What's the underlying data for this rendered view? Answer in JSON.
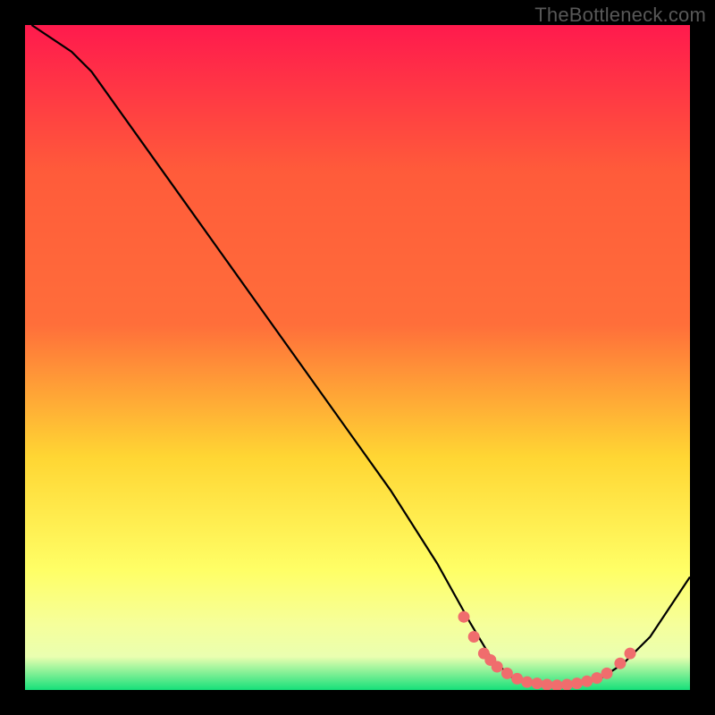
{
  "watermark": "TheBottleneck.com",
  "chart_data": {
    "type": "line",
    "title": "",
    "xlabel": "",
    "ylabel": "",
    "xlim": [
      0,
      100
    ],
    "ylim": [
      0,
      100
    ],
    "background_gradient": {
      "top": "#ff1a4d",
      "mid_upper": "#ff6e3a",
      "mid": "#ffd633",
      "lower": "#ffff66",
      "low_band": "#eaffb0",
      "bottom": "#16e07a"
    },
    "series": [
      {
        "name": "curve",
        "color": "#000000",
        "type": "line",
        "points": [
          {
            "x": 1,
            "y": 100
          },
          {
            "x": 7,
            "y": 96
          },
          {
            "x": 10,
            "y": 93
          },
          {
            "x": 15,
            "y": 86
          },
          {
            "x": 25,
            "y": 72
          },
          {
            "x": 35,
            "y": 58
          },
          {
            "x": 45,
            "y": 44
          },
          {
            "x": 55,
            "y": 30
          },
          {
            "x": 62,
            "y": 19
          },
          {
            "x": 67,
            "y": 10
          },
          {
            "x": 70,
            "y": 5
          },
          {
            "x": 73,
            "y": 2
          },
          {
            "x": 76,
            "y": 1
          },
          {
            "x": 80,
            "y": 0.7
          },
          {
            "x": 84,
            "y": 1
          },
          {
            "x": 87,
            "y": 2
          },
          {
            "x": 90,
            "y": 4
          },
          {
            "x": 94,
            "y": 8
          },
          {
            "x": 100,
            "y": 17
          }
        ]
      },
      {
        "name": "dots",
        "color": "#f06d6d",
        "type": "scatter",
        "points": [
          {
            "x": 66,
            "y": 11
          },
          {
            "x": 67.5,
            "y": 8
          },
          {
            "x": 69,
            "y": 5.5
          },
          {
            "x": 70,
            "y": 4.5
          },
          {
            "x": 71,
            "y": 3.5
          },
          {
            "x": 72.5,
            "y": 2.5
          },
          {
            "x": 74,
            "y": 1.7
          },
          {
            "x": 75.5,
            "y": 1.2
          },
          {
            "x": 77,
            "y": 1
          },
          {
            "x": 78.5,
            "y": 0.8
          },
          {
            "x": 80,
            "y": 0.7
          },
          {
            "x": 81.5,
            "y": 0.8
          },
          {
            "x": 83,
            "y": 1
          },
          {
            "x": 84.5,
            "y": 1.3
          },
          {
            "x": 86,
            "y": 1.8
          },
          {
            "x": 87.5,
            "y": 2.5
          },
          {
            "x": 89.5,
            "y": 4
          },
          {
            "x": 91,
            "y": 5.5
          }
        ]
      }
    ]
  }
}
